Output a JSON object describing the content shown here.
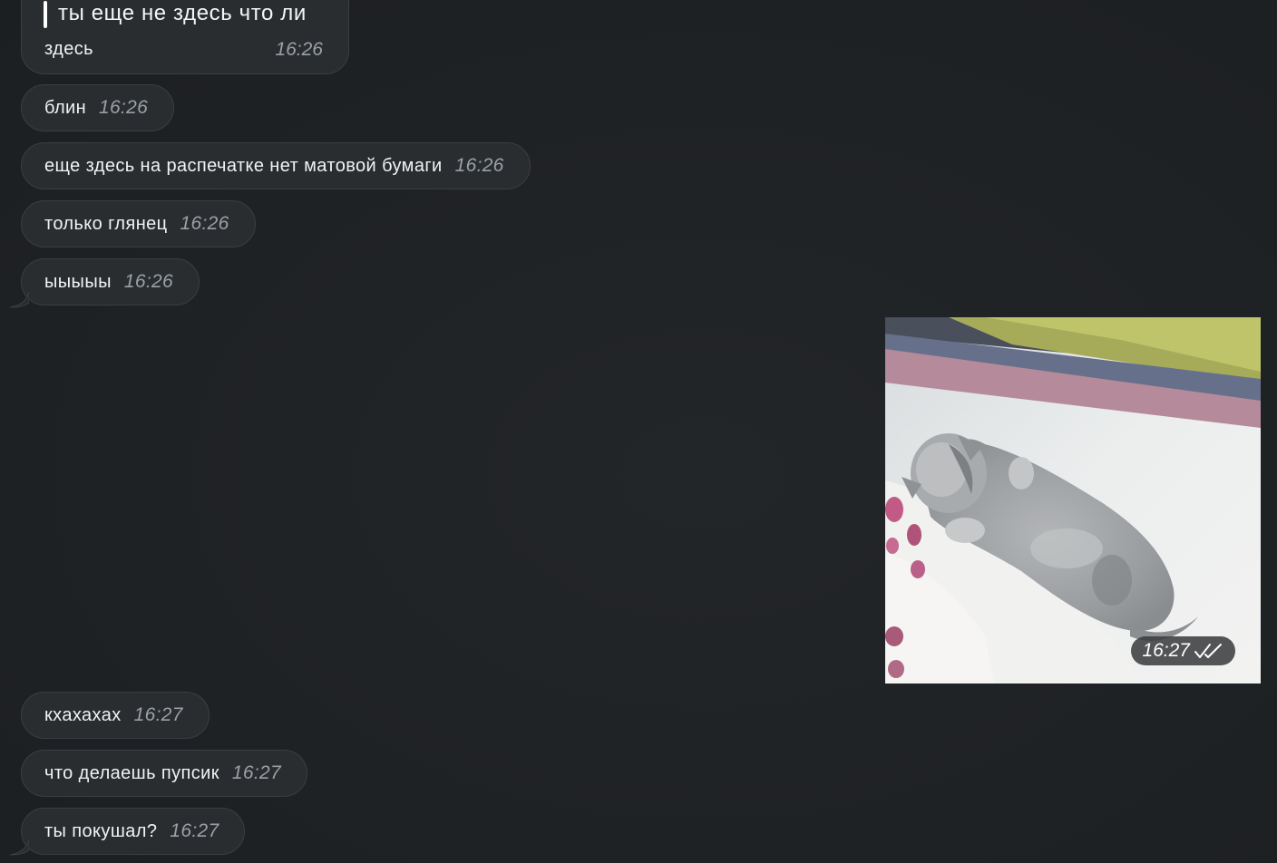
{
  "messages": {
    "reply": {
      "quote": "ты еще не здесь что ли",
      "text": "здесь",
      "time": "16:26"
    },
    "m1": {
      "text": "блин",
      "time": "16:26"
    },
    "m2": {
      "text": "еще здесь на распечатке нет матовой бумаги",
      "time": "16:26"
    },
    "m3": {
      "text": "только глянец",
      "time": "16:26"
    },
    "m4": {
      "text": "ыыыыы",
      "time": "16:26"
    },
    "gif": {
      "time": "16:27",
      "status_icon": "double-check-icon"
    },
    "m5": {
      "text": "кхахахах",
      "time": "16:27"
    },
    "m6": {
      "text": "что делаешь пупсик",
      "time": "16:27"
    },
    "m7": {
      "text": "ты покушал?",
      "time": "16:27"
    }
  },
  "colors": {
    "background": "#1f2225",
    "bubble": "#2a2d30",
    "time_text": "#9aa0a6"
  }
}
